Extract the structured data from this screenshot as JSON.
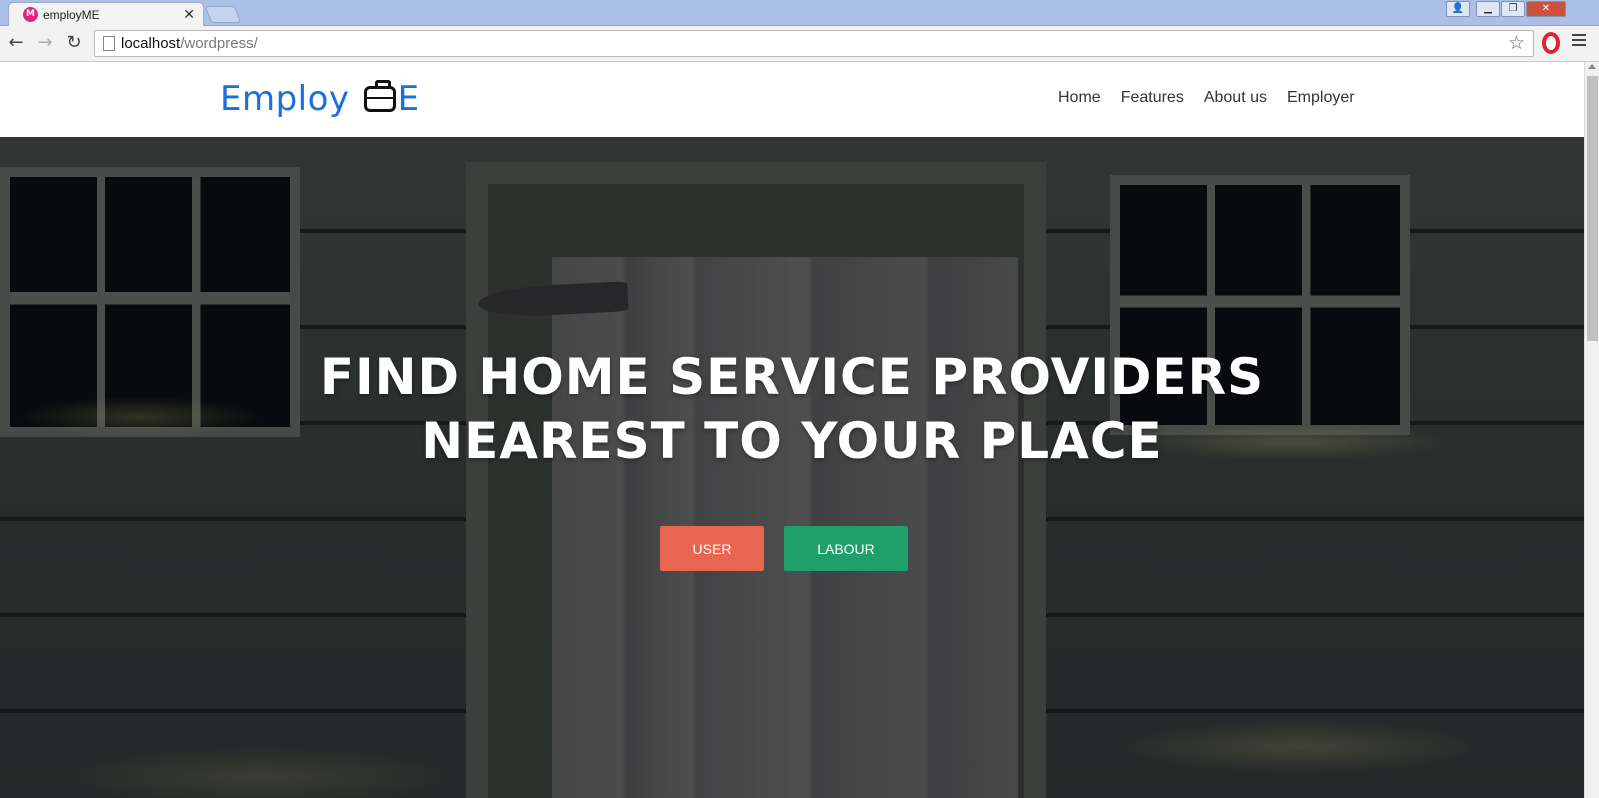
{
  "browser": {
    "tab_title": "employME",
    "tab_favicon_text": "M",
    "url_host": "localhost",
    "url_path": "/wordpress/"
  },
  "site": {
    "logo_left": "Employ",
    "logo_right": "E",
    "nav": [
      "Home",
      "Features",
      "About us",
      "Employer"
    ]
  },
  "hero": {
    "title_line1": "FIND HOME SERVICE PROVIDERS",
    "title_line2": "NEAREST TO YOUR PLACE",
    "buttons": {
      "user": "USER",
      "labour": "LABOUR"
    }
  },
  "colors": {
    "logo": "#1a6fe0",
    "user_button": "#e8664f",
    "labour_button": "#1fa06b"
  }
}
